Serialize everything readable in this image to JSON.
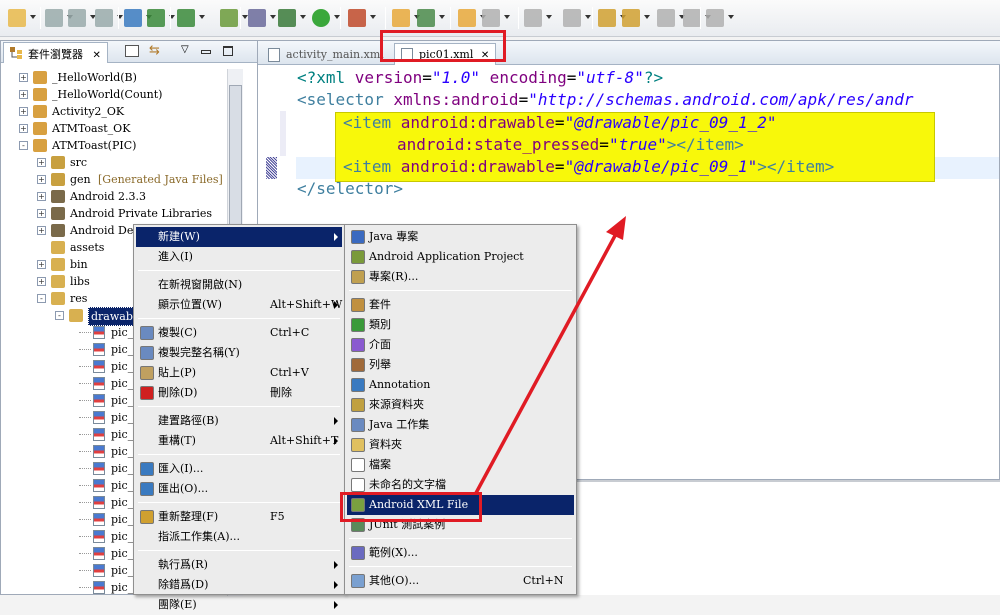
{
  "explorer": {
    "tab_label": "套件瀏覽器",
    "tree": [
      {
        "label": "_HelloWorld(B)",
        "depth": 0,
        "exp": "+"
      },
      {
        "label": "_HelloWorld(Count)",
        "depth": 0,
        "exp": "+"
      },
      {
        "label": "Activity2_OK",
        "depth": 0,
        "exp": "+"
      },
      {
        "label": "ATMToast_OK",
        "depth": 0,
        "exp": "+"
      },
      {
        "label": "ATMToast(PIC)",
        "depth": 0,
        "exp": "-"
      },
      {
        "label": "src",
        "depth": 1,
        "exp": "+"
      },
      {
        "label": "gen",
        "extra": "[Generated Java Files]",
        "depth": 1,
        "exp": "+"
      },
      {
        "label": "Android 2.3.3",
        "depth": 1,
        "exp": "+"
      },
      {
        "label": "Android Private Libraries",
        "depth": 1,
        "exp": "+"
      },
      {
        "label": "Android Dep",
        "depth": 1,
        "exp": "+"
      },
      {
        "label": "assets",
        "depth": 1,
        "exp": ""
      },
      {
        "label": "bin",
        "depth": 1,
        "exp": "+"
      },
      {
        "label": "libs",
        "depth": 1,
        "exp": "+"
      },
      {
        "label": "res",
        "depth": 1,
        "exp": "-"
      },
      {
        "label": "drawable",
        "depth": 2,
        "exp": "-"
      }
    ],
    "file_items": [
      "pic_",
      "pic_",
      "pic_",
      "pic_",
      "pic_",
      "pic_",
      "pic_",
      "pic_",
      "pic_",
      "pic_",
      "pic_",
      "pic_",
      "pic_",
      "pic_",
      "pic_",
      "pic_"
    ]
  },
  "editor": {
    "tabs": [
      {
        "label": "activity_main.xml"
      },
      {
        "label": "pic01.xml"
      }
    ],
    "code": {
      "l1_a": "<?xml ",
      "l1_b": "version",
      "l1_c": "=",
      "l1_d": "\"1.0\"",
      "l1_e": " encoding",
      "l1_f": "=",
      "l1_g": "\"utf-8\"",
      "l1_h": "?>",
      "l2_a": "<selector ",
      "l2_b": "xmlns:android",
      "l2_c": "=",
      "l2_d": "\"http://schemas.android.com/apk/res/andr",
      "l3_a": "<item ",
      "l3_b": "android:drawable",
      "l3_c": "=",
      "l3_d": "\"@drawable/pic_09_1_2\"",
      "l4_b": "android:state_pressed",
      "l4_c": "=",
      "l4_d": "\"true\"",
      "l4_e": "></item>",
      "l5_a": "<item ",
      "l5_b": "android:drawable",
      "l5_c": "=",
      "l5_d": "\"@drawable/pic_09_1\"",
      "l5_e": "></item>",
      "l6_a": "</selector>"
    }
  },
  "context_menu": {
    "items": [
      {
        "label": "新建(W)",
        "shortcut": "",
        "submenu": true,
        "selected": true
      },
      {
        "label": "進入(I)",
        "shortcut": ""
      },
      {
        "sep": true
      },
      {
        "label": "在新視窗開啟(N)",
        "shortcut": ""
      },
      {
        "label": "顯示位置(W)",
        "shortcut": "Alt+Shift+W",
        "submenu": true
      },
      {
        "sep": true
      },
      {
        "label": "複製(C)",
        "shortcut": "Ctrl+C",
        "icon": "copy"
      },
      {
        "label": "複製完整名稱(Y)",
        "shortcut": "",
        "icon": "copy"
      },
      {
        "label": "貼上(P)",
        "shortcut": "Ctrl+V",
        "icon": "paste"
      },
      {
        "label": "刪除(D)",
        "shortcut": "刪除",
        "icon": "delete"
      },
      {
        "sep": true
      },
      {
        "label": "建置路徑(B)",
        "shortcut": "",
        "submenu": true
      },
      {
        "label": "重構(T)",
        "shortcut": "Alt+Shift+T",
        "submenu": true
      },
      {
        "sep": true
      },
      {
        "label": "匯入(I)...",
        "shortcut": "",
        "icon": "import"
      },
      {
        "label": "匯出(O)...",
        "shortcut": "",
        "icon": "export"
      },
      {
        "sep": true
      },
      {
        "label": "重新整理(F)",
        "shortcut": "F5",
        "icon": "refresh"
      },
      {
        "label": "指派工作集(A)...",
        "shortcut": ""
      },
      {
        "sep": true
      },
      {
        "label": "執行爲(R)",
        "shortcut": "",
        "submenu": true
      },
      {
        "label": "除錯爲(D)",
        "shortcut": "",
        "submenu": true
      },
      {
        "label": "團隊(E)",
        "shortcut": "",
        "submenu": true
      }
    ]
  },
  "sub_menu": {
    "items": [
      {
        "label": "Java 專案",
        "icon": "java-project"
      },
      {
        "label": "Android Application Project",
        "icon": "android"
      },
      {
        "label": "專案(R)...",
        "icon": "project"
      },
      {
        "sep": true
      },
      {
        "label": "套件",
        "icon": "package"
      },
      {
        "label": "類別",
        "icon": "class"
      },
      {
        "label": "介面",
        "icon": "interface"
      },
      {
        "label": "列舉",
        "icon": "enum"
      },
      {
        "label": "Annotation",
        "icon": "annotation"
      },
      {
        "label": "來源資料夾",
        "icon": "source-folder"
      },
      {
        "label": "Java 工作集",
        "icon": "working-set"
      },
      {
        "label": "資料夾",
        "icon": "folder"
      },
      {
        "label": "檔案",
        "icon": "file"
      },
      {
        "label": "未命名的文字檔",
        "icon": "text-file"
      },
      {
        "label": "Android XML File",
        "icon": "android-xml",
        "selected": true
      },
      {
        "label": "JUnit 測試案例",
        "icon": "junit"
      },
      {
        "sep": true
      },
      {
        "label": "範例(X)...",
        "icon": "example"
      },
      {
        "sep": true
      },
      {
        "label": "其他(O)...",
        "icon": "other",
        "shortcut": "Ctrl+N"
      }
    ]
  },
  "colors": {
    "annotation_red": "#e01b24",
    "highlight_yellow": "#f8f80a",
    "menu_selected": "#0a246a"
  }
}
